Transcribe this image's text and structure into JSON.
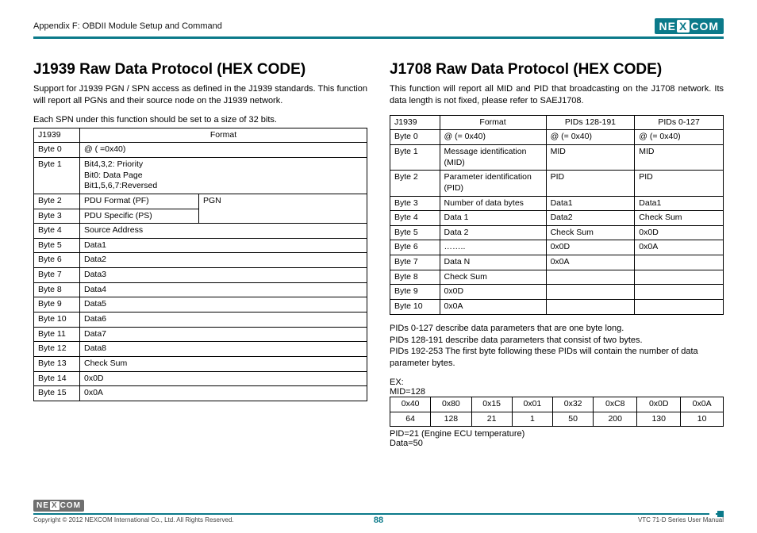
{
  "header": {
    "appendix": "Appendix F: OBDII Module Setup and Command",
    "brand": "NEXCOM"
  },
  "left": {
    "title": "J1939 Raw Data Protocol (HEX CODE)",
    "intro": "Support for J1939 PGN / SPN access as defined in the J1939 standards. This function will report all PGNs and their source node on the J1939 network.",
    "subnote": "Each SPN under this function should be set to a size of 32 bits.",
    "th1": "J1939",
    "th2": "Format",
    "rows": [
      {
        "b": "Byte 0",
        "v": "@ ( =0x40)"
      },
      {
        "b": "Byte 1",
        "v": "Bit4,3,2: Priority\nBit0: Data Page\nBit1,5,6,7:Reversed"
      },
      {
        "b": "Byte 2",
        "v": "PDU Format (PF)",
        "pgn": "PGN"
      },
      {
        "b": "Byte 3",
        "v": "PDU Specific (PS)"
      },
      {
        "b": "Byte 4",
        "v": "Source Address"
      },
      {
        "b": "Byte 5",
        "v": "Data1"
      },
      {
        "b": "Byte 6",
        "v": "Data2"
      },
      {
        "b": "Byte 7",
        "v": "Data3"
      },
      {
        "b": "Byte 8",
        "v": "Data4"
      },
      {
        "b": "Byte 9",
        "v": "Data5"
      },
      {
        "b": "Byte 10",
        "v": "Data6"
      },
      {
        "b": "Byte 11",
        "v": "Data7"
      },
      {
        "b": "Byte 12",
        "v": "Data8"
      },
      {
        "b": "Byte 13",
        "v": "Check Sum"
      },
      {
        "b": "Byte 14",
        "v": "0x0D"
      },
      {
        "b": "Byte 15",
        "v": "0x0A"
      }
    ]
  },
  "right": {
    "title": "J1708 Raw Data Protocol (HEX CODE)",
    "intro": "This function will report all MID and PID that broadcasting on the J1708 network. Its data length is not fixed, please refer to SAEJ1708.",
    "th": [
      "J1939",
      "Format",
      "PIDs 128-191",
      "PIDs 0-127"
    ],
    "rows": [
      [
        "Byte 0",
        "@ (= 0x40)",
        "@ (= 0x40)",
        "@ (= 0x40)"
      ],
      [
        "Byte 1",
        "Message identification (MID)",
        "MID",
        "MID"
      ],
      [
        "Byte 2",
        "Parameter identification (PID)",
        "PID",
        "PID"
      ],
      [
        "Byte 3",
        "Number of data bytes",
        "Data1",
        "Data1"
      ],
      [
        "Byte 4",
        "Data 1",
        "Data2",
        "Check Sum"
      ],
      [
        "Byte 5",
        "Data 2",
        "Check Sum",
        "0x0D"
      ],
      [
        "Byte 6",
        "……..",
        "0x0D",
        "0x0A"
      ],
      [
        "Byte 7",
        "Data N",
        "0x0A",
        ""
      ],
      [
        "Byte 8",
        "Check Sum",
        "",
        ""
      ],
      [
        "Byte 9",
        "0x0D",
        "",
        ""
      ],
      [
        "Byte 10",
        "0x0A",
        "",
        ""
      ]
    ],
    "notes": [
      "PIDs 0-127 describe data parameters that are one byte long.",
      "PIDs 128-191 describe data parameters that consist of two bytes.",
      "PIDs 192-253 The first byte following these PIDs will contain the number of data parameter bytes."
    ],
    "ex_label": "EX:",
    "mid": "MID=128",
    "ex_rows": [
      [
        "0x40",
        "0x80",
        "0x15",
        "0x01",
        "0x32",
        "0xC8",
        "0x0D",
        "0x0A"
      ],
      [
        "64",
        "128",
        "21",
        "1",
        "50",
        "200",
        "130",
        "10"
      ]
    ],
    "pid_line": "PID=21 (Engine ECU temperature)",
    "data_line": "Data=50"
  },
  "footer": {
    "copyright": "Copyright © 2012 NEXCOM International Co., Ltd. All Rights Reserved.",
    "page": "88",
    "manual": "VTC 71-D Series User Manual"
  }
}
